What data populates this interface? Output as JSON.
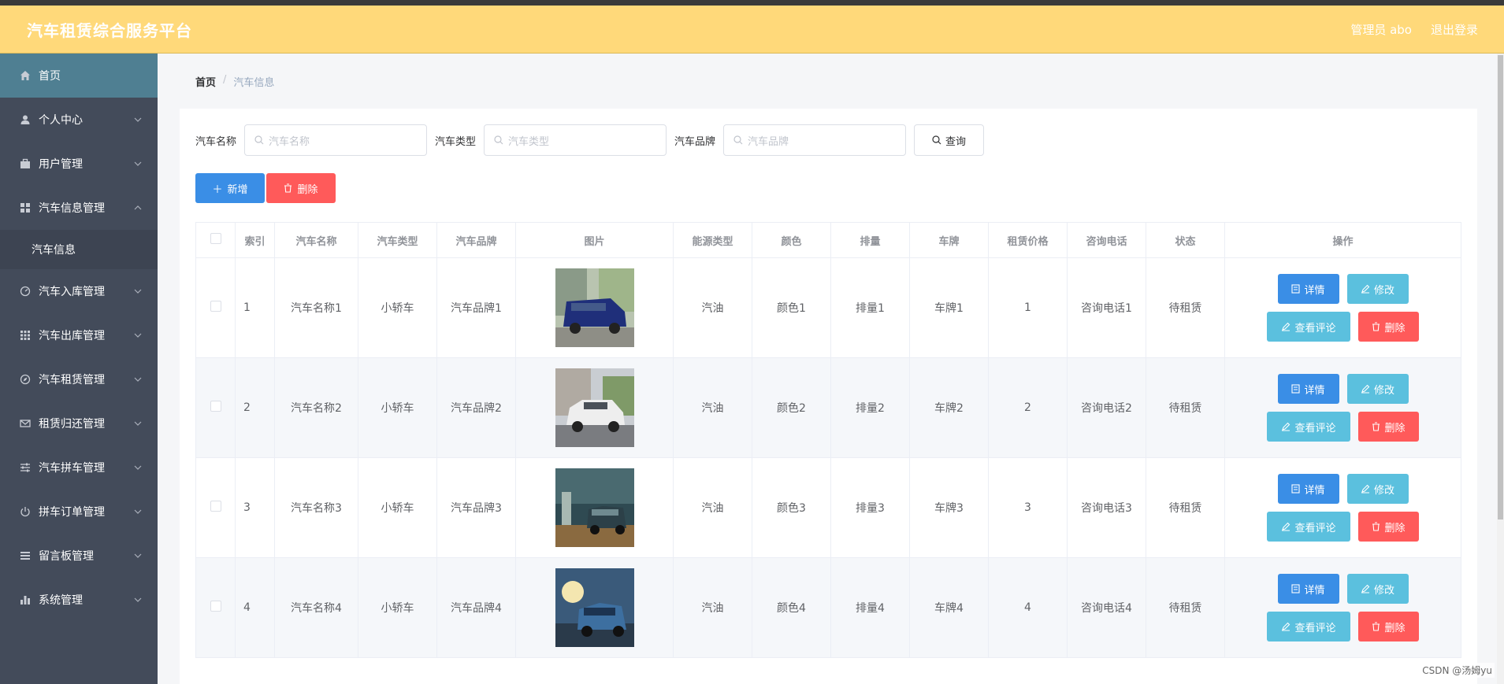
{
  "header": {
    "title": "汽车租赁综合服务平台",
    "user": "管理员 abo",
    "logout": "退出登录"
  },
  "sidebar": {
    "items": [
      {
        "label": "首页",
        "icon": "home-icon",
        "active": true
      },
      {
        "label": "个人中心",
        "icon": "user-icon"
      },
      {
        "label": "用户管理",
        "icon": "briefcase-icon"
      },
      {
        "label": "汽车信息管理",
        "icon": "grid-icon",
        "expanded": true,
        "sub": "汽车信息"
      },
      {
        "label": "汽车入库管理",
        "icon": "gauge-icon"
      },
      {
        "label": "汽车出库管理",
        "icon": "apps-icon"
      },
      {
        "label": "汽车租赁管理",
        "icon": "compass-icon"
      },
      {
        "label": "租赁归还管理",
        "icon": "mail-icon"
      },
      {
        "label": "汽车拼车管理",
        "icon": "sliders-icon"
      },
      {
        "label": "拼车订单管理",
        "icon": "power-icon"
      },
      {
        "label": "留言板管理",
        "icon": "list-icon"
      },
      {
        "label": "系统管理",
        "icon": "bar-chart-icon"
      }
    ]
  },
  "breadcrumb": {
    "home": "首页",
    "current": "汽车信息"
  },
  "search": {
    "name_label": "汽车名称",
    "name_placeholder": "汽车名称",
    "type_label": "汽车类型",
    "type_placeholder": "汽车类型",
    "brand_label": "汽车品牌",
    "brand_placeholder": "汽车品牌",
    "button": "查询"
  },
  "actions": {
    "add": "新增",
    "delete": "删除"
  },
  "table": {
    "headers": [
      "索引",
      "汽车名称",
      "汽车类型",
      "汽车品牌",
      "图片",
      "能源类型",
      "颜色",
      "排量",
      "车牌",
      "租赁价格",
      "咨询电话",
      "状态",
      "操作"
    ],
    "rows": [
      {
        "index": "1",
        "name": "汽车名称1",
        "type": "小轿车",
        "brand": "汽车品牌1",
        "energy": "汽油",
        "color": "颜色1",
        "displacement": "排量1",
        "plate": "车牌1",
        "price": "1",
        "phone": "咨询电话1",
        "status": "待租赁"
      },
      {
        "index": "2",
        "name": "汽车名称2",
        "type": "小轿车",
        "brand": "汽车品牌2",
        "energy": "汽油",
        "color": "颜色2",
        "displacement": "排量2",
        "plate": "车牌2",
        "price": "2",
        "phone": "咨询电话2",
        "status": "待租赁"
      },
      {
        "index": "3",
        "name": "汽车名称3",
        "type": "小轿车",
        "brand": "汽车品牌3",
        "energy": "汽油",
        "color": "颜色3",
        "displacement": "排量3",
        "plate": "车牌3",
        "price": "3",
        "phone": "咨询电话3",
        "status": "待租赁"
      },
      {
        "index": "4",
        "name": "汽车名称4",
        "type": "小轿车",
        "brand": "汽车品牌4",
        "energy": "汽油",
        "color": "颜色4",
        "displacement": "排量4",
        "plate": "车牌4",
        "price": "4",
        "phone": "咨询电话4",
        "status": "待租赁"
      }
    ],
    "row_ops": {
      "detail": "详情",
      "edit": "修改",
      "review": "查看评论",
      "delete": "删除"
    }
  },
  "watermark": "CSDN @汤姆yu",
  "colors": {
    "header": "#ffd97a",
    "sidebar": "#434b5a",
    "sidebar_active": "#4f7f92",
    "primary": "#3a8ee6",
    "info": "#5bc0de",
    "danger": "#ff5a5a"
  }
}
